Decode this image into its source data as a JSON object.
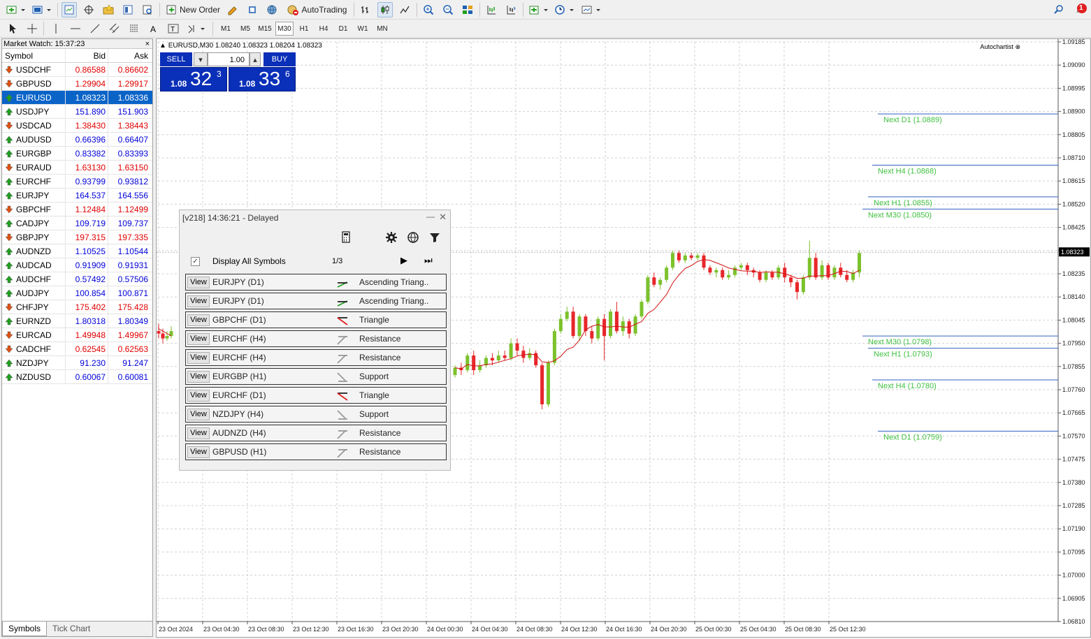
{
  "toolbar": {
    "new_order": "New Order",
    "auto_trading": "AutoTrading",
    "notification_count": "1",
    "timeframes": [
      "M1",
      "M5",
      "M15",
      "M30",
      "H1",
      "H4",
      "D1",
      "W1",
      "MN"
    ],
    "active_timeframe": "M30"
  },
  "market_watch": {
    "title": "Market Watch: 15:37:23",
    "close": "×",
    "col_symbol": "Symbol",
    "col_bid": "Bid",
    "col_ask": "Ask",
    "rows": [
      {
        "symbol": "USDCHF",
        "bid": "0.86588",
        "ask": "0.86602",
        "dir": "down"
      },
      {
        "symbol": "GBPUSD",
        "bid": "1.29904",
        "ask": "1.29917",
        "dir": "down"
      },
      {
        "symbol": "EURUSD",
        "bid": "1.08323",
        "ask": "1.08336",
        "dir": "up",
        "selected": true
      },
      {
        "symbol": "USDJPY",
        "bid": "151.890",
        "ask": "151.903",
        "dir": "up"
      },
      {
        "symbol": "USDCAD",
        "bid": "1.38430",
        "ask": "1.38443",
        "dir": "down"
      },
      {
        "symbol": "AUDUSD",
        "bid": "0.66396",
        "ask": "0.66407",
        "dir": "up"
      },
      {
        "symbol": "EURGBP",
        "bid": "0.83382",
        "ask": "0.83393",
        "dir": "up"
      },
      {
        "symbol": "EURAUD",
        "bid": "1.63130",
        "ask": "1.63150",
        "dir": "down"
      },
      {
        "symbol": "EURCHF",
        "bid": "0.93799",
        "ask": "0.93812",
        "dir": "up"
      },
      {
        "symbol": "EURJPY",
        "bid": "164.537",
        "ask": "164.556",
        "dir": "up"
      },
      {
        "symbol": "GBPCHF",
        "bid": "1.12484",
        "ask": "1.12499",
        "dir": "down"
      },
      {
        "symbol": "CADJPY",
        "bid": "109.719",
        "ask": "109.737",
        "dir": "up"
      },
      {
        "symbol": "GBPJPY",
        "bid": "197.315",
        "ask": "197.335",
        "dir": "down"
      },
      {
        "symbol": "AUDNZD",
        "bid": "1.10525",
        "ask": "1.10544",
        "dir": "up"
      },
      {
        "symbol": "AUDCAD",
        "bid": "0.91909",
        "ask": "0.91931",
        "dir": "up"
      },
      {
        "symbol": "AUDCHF",
        "bid": "0.57492",
        "ask": "0.57506",
        "dir": "up"
      },
      {
        "symbol": "AUDJPY",
        "bid": "100.854",
        "ask": "100.871",
        "dir": "up"
      },
      {
        "symbol": "CHFJPY",
        "bid": "175.402",
        "ask": "175.428",
        "dir": "down"
      },
      {
        "symbol": "EURNZD",
        "bid": "1.80318",
        "ask": "1.80349",
        "dir": "up"
      },
      {
        "symbol": "EURCAD",
        "bid": "1.49948",
        "ask": "1.49967",
        "dir": "down"
      },
      {
        "symbol": "CADCHF",
        "bid": "0.62545",
        "ask": "0.62563",
        "dir": "down"
      },
      {
        "symbol": "NZDJPY",
        "bid": "91.230",
        "ask": "91.247",
        "dir": "up"
      },
      {
        "symbol": "NZDUSD",
        "bid": "0.60067",
        "ask": "0.60081",
        "dir": "up"
      }
    ],
    "tabs": [
      "Symbols",
      "Tick Chart"
    ]
  },
  "chart": {
    "header": "EURUSD,M30  1.08240 1.08323 1.08204 1.08323",
    "autochartist": "Autochartist",
    "current_price": "1.08323",
    "colors": {
      "bull": "#7cc22c",
      "bear": "#e8262a",
      "ma": "#d01010",
      "level_line": "#3060c0",
      "level_text": "#40c040"
    },
    "one_click": {
      "sell": "SELL",
      "buy": "BUY",
      "lot": "1.00",
      "sell_small": "1.08",
      "sell_big": "32",
      "sell_sup": "3",
      "buy_small": "1.08",
      "buy_big": "33",
      "buy_sup": "6"
    }
  },
  "chart_data": {
    "type": "candlestick",
    "symbol": "EURUSD",
    "timeframe": "M30",
    "ylim": [
      1.0681,
      1.09185
    ],
    "y_ticks": [
      "1.09185",
      "1.09090",
      "1.08995",
      "1.08900",
      "1.08805",
      "1.08710",
      "1.08615",
      "1.08520",
      "1.08425",
      "1.08330",
      "1.08235",
      "1.08140",
      "1.08045",
      "1.07950",
      "1.07855",
      "1.07760",
      "1.07665",
      "1.07570",
      "1.07475",
      "1.07380",
      "1.07285",
      "1.07190",
      "1.07095",
      "1.07000",
      "1.06905",
      "1.06810"
    ],
    "x_ticks": [
      "23 Oct 2024",
      "23 Oct 04:30",
      "23 Oct 08:30",
      "23 Oct 12:30",
      "23 Oct 16:30",
      "23 Oct 20:30",
      "24 Oct 00:30",
      "24 Oct 04:30",
      "24 Oct 08:30",
      "24 Oct 12:30",
      "24 Oct 16:30",
      "24 Oct 20:30",
      "25 Oct 00:30",
      "25 Oct 04:30",
      "25 Oct 08:30",
      "25 Oct 12:30"
    ],
    "levels": [
      {
        "label": "Next D1 (1.0889)",
        "value": 1.0889
      },
      {
        "label": "Next H4 (1.0868)",
        "value": 1.0868
      },
      {
        "label": "Next H1 (1.0855)",
        "value": 1.0855
      },
      {
        "label": "Next M30 (1.0850)",
        "value": 1.085
      },
      {
        "label": "Next M30 (1.0798)",
        "value": 1.0798
      },
      {
        "label": "Next H1 (1.0793)",
        "value": 1.0793
      },
      {
        "label": "Next H4 (1.0780)",
        "value": 1.078
      },
      {
        "label": "Next D1 (1.0759)",
        "value": 1.0759
      }
    ],
    "candles": [
      [
        1.08,
        1.0799,
        1.0803,
        1.0797
      ],
      [
        1.0799,
        1.0797,
        1.0801,
        1.0795
      ],
      [
        1.0797,
        1.0798,
        1.08,
        1.0796
      ],
      [
        1.0798,
        1.08,
        1.0802,
        1.0797
      ],
      [
        1.0782,
        1.0785,
        1.0786,
        1.0781
      ],
      [
        1.0785,
        1.0784,
        1.0787,
        1.0782
      ],
      [
        1.0784,
        1.079,
        1.0791,
        1.0783
      ],
      [
        1.079,
        1.0784,
        1.0792,
        1.0782
      ],
      [
        1.0784,
        1.0786,
        1.0788,
        1.0783
      ],
      [
        1.0786,
        1.0789,
        1.079,
        1.0785
      ],
      [
        1.0789,
        1.0788,
        1.0791,
        1.0786
      ],
      [
        1.0788,
        1.079,
        1.0792,
        1.0787
      ],
      [
        1.079,
        1.0789,
        1.0792,
        1.0788
      ],
      [
        1.0789,
        1.0795,
        1.0797,
        1.0788
      ],
      [
        1.0795,
        1.0792,
        1.0797,
        1.079
      ],
      [
        1.0792,
        1.0789,
        1.0794,
        1.0787
      ],
      [
        1.0789,
        1.0791,
        1.0793,
        1.0788
      ],
      [
        1.0791,
        1.0786,
        1.0792,
        1.0785
      ],
      [
        1.0786,
        1.077,
        1.0787,
        1.0768
      ],
      [
        1.077,
        1.0787,
        1.0788,
        1.0769
      ],
      [
        1.0787,
        1.08,
        1.0801,
        1.0786
      ],
      [
        1.08,
        1.0805,
        1.0807,
        1.0799
      ],
      [
        1.0805,
        1.0808,
        1.081,
        1.0804
      ],
      [
        1.0808,
        1.0798,
        1.081,
        1.0797
      ],
      [
        1.0798,
        1.0806,
        1.0807,
        1.0796
      ],
      [
        1.0806,
        1.08,
        1.0807,
        1.0798
      ],
      [
        1.08,
        1.0797,
        1.0802,
        1.0795
      ],
      [
        1.0797,
        1.0805,
        1.0806,
        1.0796
      ],
      [
        1.0805,
        1.0798,
        1.0807,
        1.0788
      ],
      [
        1.0798,
        1.0808,
        1.0809,
        1.0797
      ],
      [
        1.0808,
        1.08,
        1.0812,
        1.0799
      ],
      [
        1.08,
        1.0804,
        1.0806,
        1.0798
      ],
      [
        1.0804,
        1.0799,
        1.0805,
        1.0797
      ],
      [
        1.0799,
        1.0806,
        1.0807,
        1.0798
      ],
      [
        1.0806,
        1.0812,
        1.0813,
        1.0805
      ],
      [
        1.0812,
        1.0822,
        1.0823,
        1.0811
      ],
      [
        1.0822,
        1.0819,
        1.0824,
        1.0818
      ],
      [
        1.0819,
        1.0821,
        1.0822,
        1.0817
      ],
      [
        1.0821,
        1.0826,
        1.0827,
        1.082
      ],
      [
        1.0826,
        1.0832,
        1.0833,
        1.0825
      ],
      [
        1.0832,
        1.0829,
        1.0833,
        1.0828
      ],
      [
        1.0829,
        1.0831,
        1.0832,
        1.0828
      ],
      [
        1.0831,
        1.083,
        1.0832,
        1.0829
      ],
      [
        1.083,
        1.0831,
        1.0832,
        1.0829
      ],
      [
        1.0831,
        1.0826,
        1.0832,
        1.0825
      ],
      [
        1.0826,
        1.0824,
        1.0827,
        1.0823
      ],
      [
        1.0824,
        1.0825,
        1.0826,
        1.0822
      ],
      [
        1.0825,
        1.0822,
        1.0826,
        1.0821
      ],
      [
        1.0822,
        1.0823,
        1.0825,
        1.0821
      ],
      [
        1.0823,
        1.0826,
        1.0827,
        1.0822
      ],
      [
        1.0826,
        1.0827,
        1.0828,
        1.0825
      ],
      [
        1.0827,
        1.0825,
        1.0828,
        1.0823
      ],
      [
        1.0825,
        1.0824,
        1.0826,
        1.0822
      ],
      [
        1.0824,
        1.0821,
        1.0825,
        1.082
      ],
      [
        1.0821,
        1.0824,
        1.0825,
        1.082
      ],
      [
        1.0824,
        1.0822,
        1.0825,
        1.0821
      ],
      [
        1.0822,
        1.0826,
        1.0827,
        1.0821
      ],
      [
        1.0826,
        1.0822,
        1.0828,
        1.082
      ],
      [
        1.0822,
        1.082,
        1.0823,
        1.0818
      ],
      [
        1.082,
        1.0816,
        1.0821,
        1.0813
      ],
      [
        1.0816,
        1.0822,
        1.0823,
        1.0815
      ],
      [
        1.0822,
        1.083,
        1.0837,
        1.0821
      ],
      [
        1.083,
        1.0822,
        1.0832,
        1.0821
      ],
      [
        1.0822,
        1.0827,
        1.0829,
        1.0821
      ],
      [
        1.0827,
        1.0822,
        1.0828,
        1.0821
      ],
      [
        1.0822,
        1.0826,
        1.0827,
        1.0821
      ],
      [
        1.0826,
        1.0823,
        1.0828,
        1.0822
      ],
      [
        1.0823,
        1.0821,
        1.0825,
        1.082
      ],
      [
        1.0821,
        1.0824,
        1.0825,
        1.082
      ],
      [
        1.0824,
        1.0832,
        1.0833,
        1.0822
      ]
    ]
  },
  "ac_dialog": {
    "title": "[v218] 14:36:21 - Delayed",
    "min": "—",
    "close": "✕",
    "checkbox": "✓",
    "display_all": "Display All Symbols",
    "page": "1/3",
    "play": "▶",
    "last": "⏭",
    "rows": [
      {
        "view": "View",
        "symbol": "EURJPY (D1)",
        "pattern": "Ascending Triang..",
        "icon": "ascending-triangle"
      },
      {
        "view": "View",
        "symbol": "EURJPY (D1)",
        "pattern": "Ascending Triang..",
        "icon": "ascending-triangle"
      },
      {
        "view": "View",
        "symbol": "GBPCHF (D1)",
        "pattern": "Triangle",
        "icon": "triangle"
      },
      {
        "view": "View",
        "symbol": "EURCHF (H4)",
        "pattern": "Resistance",
        "icon": "resistance"
      },
      {
        "view": "View",
        "symbol": "EURCHF (H4)",
        "pattern": "Resistance",
        "icon": "resistance"
      },
      {
        "view": "View",
        "symbol": "EURGBP (H1)",
        "pattern": "Support",
        "icon": "support"
      },
      {
        "view": "View",
        "symbol": "EURCHF (D1)",
        "pattern": "Triangle",
        "icon": "triangle"
      },
      {
        "view": "View",
        "symbol": "NZDJPY (H4)",
        "pattern": "Support",
        "icon": "support"
      },
      {
        "view": "View",
        "symbol": "AUDNZD (H4)",
        "pattern": "Resistance",
        "icon": "resistance"
      },
      {
        "view": "View",
        "symbol": "GBPUSD (H1)",
        "pattern": "Resistance",
        "icon": "resistance"
      }
    ]
  }
}
